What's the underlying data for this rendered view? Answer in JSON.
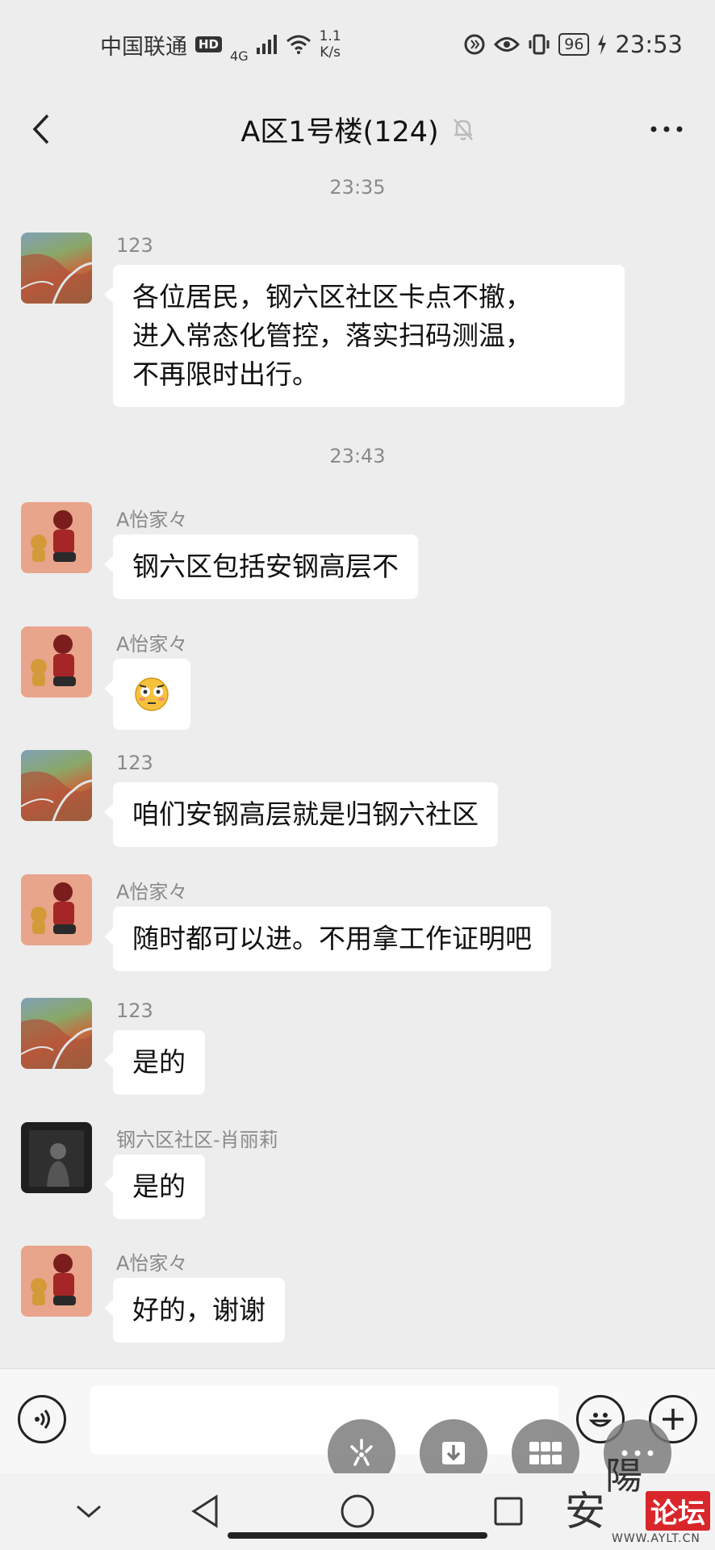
{
  "status_bar": {
    "carrier": "中国联通",
    "hd": "HD",
    "network": "4G",
    "speed_value": "1.1",
    "speed_unit": "K/s",
    "battery": "96",
    "time": "23:53"
  },
  "header": {
    "title": "A区1号楼(124)"
  },
  "timestamps": [
    "23:35",
    "23:43"
  ],
  "messages": [
    {
      "sender": "123",
      "lines": [
        "各位居民，钢六区社区卡点不撤，",
        "进入常态化管控，落实扫码测温，",
        "不再限时出行。"
      ]
    },
    {
      "sender": "A怡家々",
      "text": "钢六区包括安钢高层不"
    },
    {
      "sender": "A怡家々",
      "emoji": "😳"
    },
    {
      "sender": "123",
      "text": "咱们安钢高层就是归钢六社区"
    },
    {
      "sender": "A怡家々",
      "text": "随时都可以进。不用拿工作证明吧"
    },
    {
      "sender": "123",
      "text": "是的"
    },
    {
      "sender": "钢六区社区-肖丽莉",
      "text": "是的"
    },
    {
      "sender": "A怡家々",
      "text": "好的，谢谢"
    }
  ],
  "input": {
    "placeholder": ""
  },
  "watermark": {
    "char1": "安",
    "char2": "陽",
    "badge": "论坛",
    "url": "WWW.AYLT.CN"
  },
  "icons": [
    "back-icon",
    "more-icon",
    "mute-bell-icon",
    "voice-icon",
    "emoji-icon",
    "plus-icon"
  ]
}
